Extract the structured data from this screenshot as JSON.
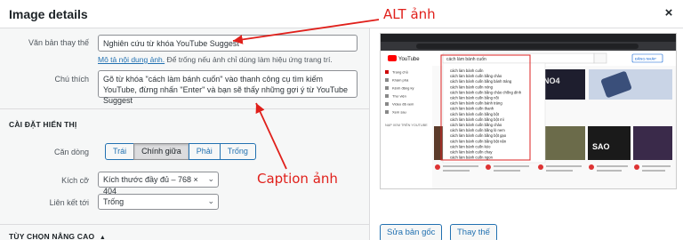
{
  "dialog": {
    "title": "Image details",
    "close_label": "×"
  },
  "alt": {
    "label": "Văn bản thay thế",
    "value": "Nghiên cứu từ khóa YouTube Suggest",
    "help_link": "Mô tả nội dung ảnh.",
    "help_rest": " Để trống nếu ảnh chỉ dùng làm hiệu ứng trang trí."
  },
  "caption": {
    "label": "Chú thích",
    "value": "Gõ từ khóa \"cách làm bánh cuốn\" vào thanh công cụ tìm kiếm YouTube, đừng nhấn \"Enter\" và bạn sẽ thấy những gợi ý từ YouTube Suggest"
  },
  "display": {
    "section_title": "CÀI ĐẶT HIỂN THỊ",
    "align_label": "Căn dòng",
    "align_options": [
      "Trái",
      "Chính giữa",
      "Phải",
      "Trống"
    ],
    "align_selected": "Chính giữa",
    "size_label": "Kích cỡ",
    "size_value": "Kích thước đầy đủ – 768 × 404",
    "link_label": "Liên kết tới",
    "link_value": "Trống"
  },
  "advanced": {
    "section_title": "TÙY CHỌN NÂNG CAO"
  },
  "buttons": {
    "edit_original": "Sửa bản gốc",
    "replace": "Thay thế"
  },
  "annotations": {
    "alt": "ALT ảnh",
    "caption": "Caption ảnh",
    "color": "#e0201b"
  },
  "preview": {
    "logo": "YouTube",
    "search_text": "cách làm bánh cuốn",
    "suggestions": [
      "cách làm bánh cuốn",
      "cách làm bánh cuốn bằng chảo",
      "cách làm bánh cuốn bằng bánh tráng",
      "cách làm bánh cuốn nóng",
      "cách làm bánh cuốn bằng chảo chống dính",
      "cách làm bánh cuốn bằng nồi",
      "cách làm bánh cuốn bánh tráng",
      "cách làm bánh cuốn thanh",
      "cách làm bánh cuốn bằng bột",
      "cách làm bánh cuốn bằng bột mì",
      "cách làm bánh cuốn bằng chảo",
      "cách làm bánh cuốn bằng lò nem",
      "cách làm bánh cuốn bằng bột gạo",
      "cách làm bánh cuốn bằng bột năn",
      "cách làm bánh cuốn kéo",
      "cách làm bánh cuốn chay",
      "cách làm bánh cuốn ngon"
    ],
    "sidebar_items": [
      "Trang chủ",
      "Khám phá",
      "Kênh đăng ký",
      "Thư viện",
      "Video đã xem",
      "Xem sau"
    ],
    "sidebar_section": "KÊNH ĐĂNG KÝ",
    "sign_in": "ĐĂNG NHẬP",
    "more_label": "NẠP XEM TRÊN YOUTUBE"
  }
}
